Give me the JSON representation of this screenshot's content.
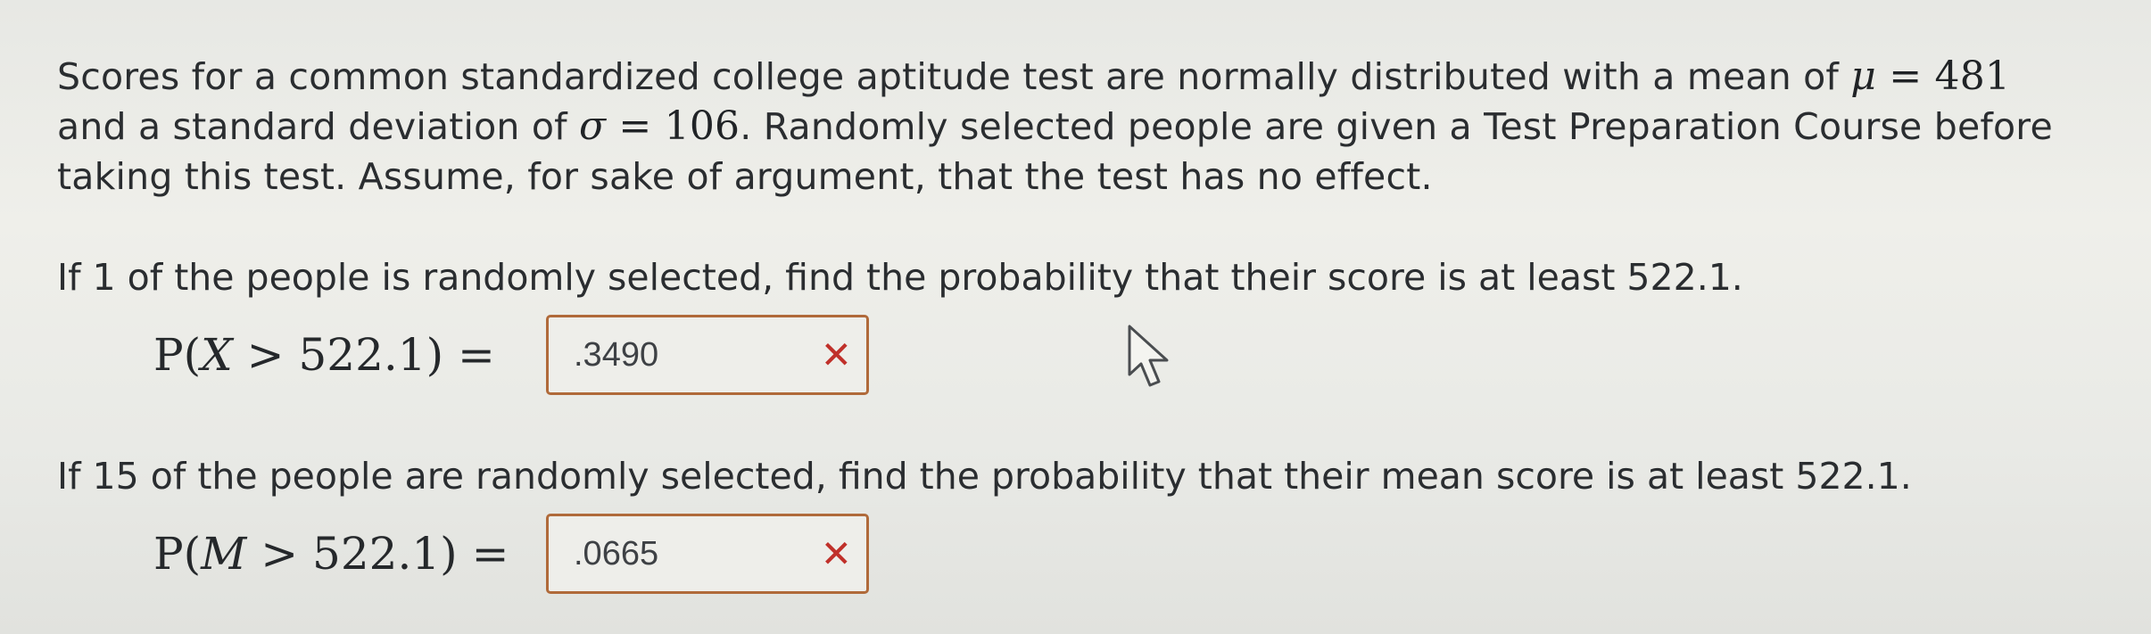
{
  "problem": {
    "intro_a": "Scores for a common standardized college aptitude test are normally distributed with a mean of ",
    "mu_symbol": "μ",
    "equals": " = ",
    "mean_value": "481",
    "intro_b": "and a standard deviation of ",
    "sigma_symbol": "σ",
    "sd_value": "106",
    "intro_c": ". Randomly selected people are given a Test Preparation Course before taking this test. Assume, for sake of argument, that the test has no effect."
  },
  "parts": [
    {
      "question": "If 1 of the people is randomly selected, find the probability that their score is at least 522.1.",
      "expr_prefix": "P(",
      "expr_var": "X",
      "expr_suffix": " > 522.1) =",
      "answer_value": ".3490",
      "status_mark": "✕"
    },
    {
      "question": "If 15 of the people are randomly selected, find the probability that their mean score is at least 522.1.",
      "expr_prefix": "P(",
      "expr_var": "M",
      "expr_suffix": " > 522.1) =",
      "answer_value": ".0665",
      "status_mark": "✕"
    }
  ],
  "icons": {
    "incorrect": "close-icon",
    "pointer": "mouse-cursor-icon"
  },
  "colors": {
    "incorrect_mark": "#c0302a",
    "answer_border": "#b06a3a"
  }
}
